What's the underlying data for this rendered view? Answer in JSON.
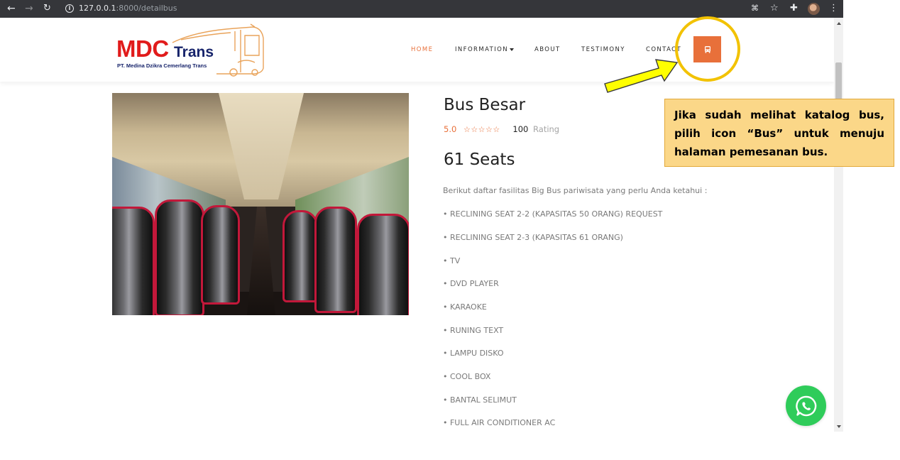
{
  "browser": {
    "url_host": "127.0.0.1",
    "url_path": ":8000/detailbus",
    "nav_icons": [
      "back-arrow-icon",
      "forward-arrow-icon",
      "reload-icon",
      "site-info-icon"
    ],
    "toolbar_icons": [
      "translate-icon",
      "bookmark-star-icon",
      "extensions-puzzle-icon",
      "profile-avatar",
      "menu-kebab-icon"
    ]
  },
  "site": {
    "logo": {
      "brand_main": "MDC",
      "brand_accent": "Trans",
      "subtitle": "PT. Medina Dzikra Cemerlang Trans"
    },
    "nav": [
      {
        "label": "HOME",
        "active": true
      },
      {
        "label": "INFORMATION",
        "dropdown": true
      },
      {
        "label": "ABOUT"
      },
      {
        "label": "TESTIMONY"
      },
      {
        "label": "CONTACT"
      }
    ],
    "bus_button_icon": "bus-icon",
    "accent_color": "#e8703a"
  },
  "detail": {
    "title": "Bus Besar",
    "rating": "5.0",
    "stars": "☆☆☆☆☆",
    "rating_count": "100",
    "rating_label": "Rating",
    "seats": "61 Seats",
    "facilities_intro": "Berikut daftar fasilitas Big Bus pariwisata yang perlu Anda ketahui :",
    "facilities": [
      "• RECLINING SEAT 2-2 (KAPASITAS 50 ORANG) REQUEST",
      "• RECLINING SEAT 2-3 (KAPASITAS 61 ORANG)",
      "• TV",
      "• DVD PLAYER",
      "• KARAOKE",
      "• RUNING TEXT",
      "• LAMPU DISKO",
      "• COOL BOX",
      "• BANTAL SELIMUT",
      "• FULL AIR CONDITIONER AC"
    ],
    "photo": "bus-interior-photo"
  },
  "annotation": {
    "callout_text": "Jika sudah melihat katalog bus, pilih icon “Bus” untuk menuju halaman pemesanan bus.",
    "callout_color": "#fbd788",
    "ring_color": "#f2c200",
    "arrow_color": "#ffff00"
  },
  "whatsapp_icon": "whatsapp-icon"
}
